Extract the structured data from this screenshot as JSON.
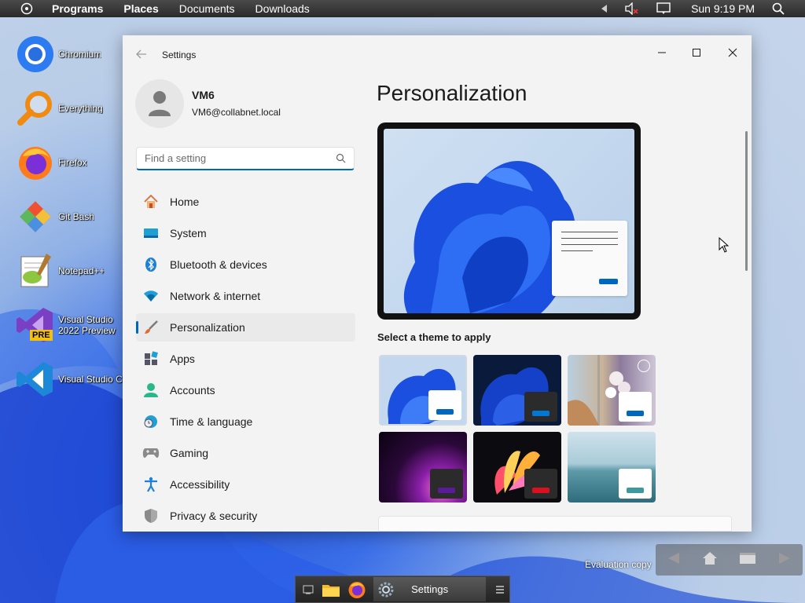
{
  "top_panel": {
    "menu": [
      "Programs",
      "Places",
      "Documents",
      "Downloads"
    ],
    "clock": "Sun 9:19 PM",
    "icons": [
      "system-menu-icon",
      "arrow-left-icon",
      "speaker-muted-icon",
      "display-icon",
      "search-icon"
    ]
  },
  "desktop_icons": [
    {
      "label": "Chromium",
      "icon": "chromium-icon"
    },
    {
      "label": "Everything",
      "icon": "everything-search-icon"
    },
    {
      "label": "Firefox",
      "icon": "firefox-icon"
    },
    {
      "label": "Git Bash",
      "icon": "git-icon"
    },
    {
      "label": "Notepad++",
      "icon": "notepadpp-icon"
    },
    {
      "label": "Visual Studio 2022 Preview",
      "icon": "visual-studio-icon",
      "badge": "PRE"
    },
    {
      "label": "Visual Studio Code",
      "icon": "vscode-icon"
    }
  ],
  "window": {
    "title": "Settings",
    "profile": {
      "name": "VM6",
      "email": "VM6@collabnet.local"
    },
    "search": {
      "placeholder": "Find a setting",
      "value": ""
    },
    "nav": [
      {
        "label": "Home",
        "icon": "home-icon"
      },
      {
        "label": "System",
        "icon": "system-icon"
      },
      {
        "label": "Bluetooth & devices",
        "icon": "bluetooth-icon"
      },
      {
        "label": "Network & internet",
        "icon": "wifi-icon"
      },
      {
        "label": "Personalization",
        "icon": "brush-icon",
        "active": true
      },
      {
        "label": "Apps",
        "icon": "apps-icon"
      },
      {
        "label": "Accounts",
        "icon": "accounts-icon"
      },
      {
        "label": "Time & language",
        "icon": "time-language-icon"
      },
      {
        "label": "Gaming",
        "icon": "gamepad-icon"
      },
      {
        "label": "Accessibility",
        "icon": "accessibility-icon"
      },
      {
        "label": "Privacy & security",
        "icon": "shield-icon"
      }
    ],
    "page_title": "Personalization",
    "themes_label": "Select a theme to apply"
  },
  "taskbar": {
    "settings_label": "Settings",
    "icons": [
      "show-desktop-icon",
      "file-explorer-icon",
      "firefox-icon",
      "settings-gear-icon",
      "menu-icon"
    ]
  },
  "watermark": "Evaluation copy",
  "colors": {
    "accent": "#0067c0",
    "window_bg": "#f3f3f3",
    "panel_bg": "#2a2a2a"
  }
}
